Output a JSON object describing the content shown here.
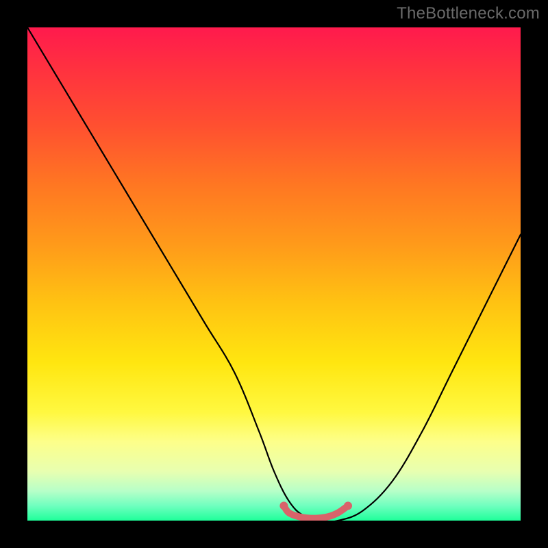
{
  "watermark": {
    "text": "TheBottleneck.com"
  },
  "chart_data": {
    "type": "line",
    "title": "",
    "xlabel": "",
    "ylabel": "",
    "xlim": [
      0,
      100
    ],
    "ylim": [
      0,
      100
    ],
    "grid": false,
    "legend": false,
    "series": [
      {
        "name": "bottleneck-curve",
        "x": [
          0,
          6,
          12,
          18,
          24,
          30,
          36,
          42,
          47,
          50,
          53,
          56,
          60,
          63,
          68,
          74,
          80,
          86,
          92,
          98,
          100
        ],
        "values": [
          100,
          90,
          80,
          70,
          60,
          50,
          40,
          30,
          18,
          10,
          4,
          1,
          0,
          0,
          2,
          8,
          18,
          30,
          42,
          54,
          58
        ]
      },
      {
        "name": "optimal-range-marker",
        "x": [
          52,
          53,
          55,
          57,
          59,
          61,
          63,
          65
        ],
        "values": [
          3.0,
          1.6,
          0.8,
          0.5,
          0.5,
          0.8,
          1.6,
          3.0
        ]
      }
    ],
    "background_gradient": {
      "top": "#ff1a4d",
      "mid": "#ffe610",
      "bottom": "#1fff9a"
    }
  }
}
